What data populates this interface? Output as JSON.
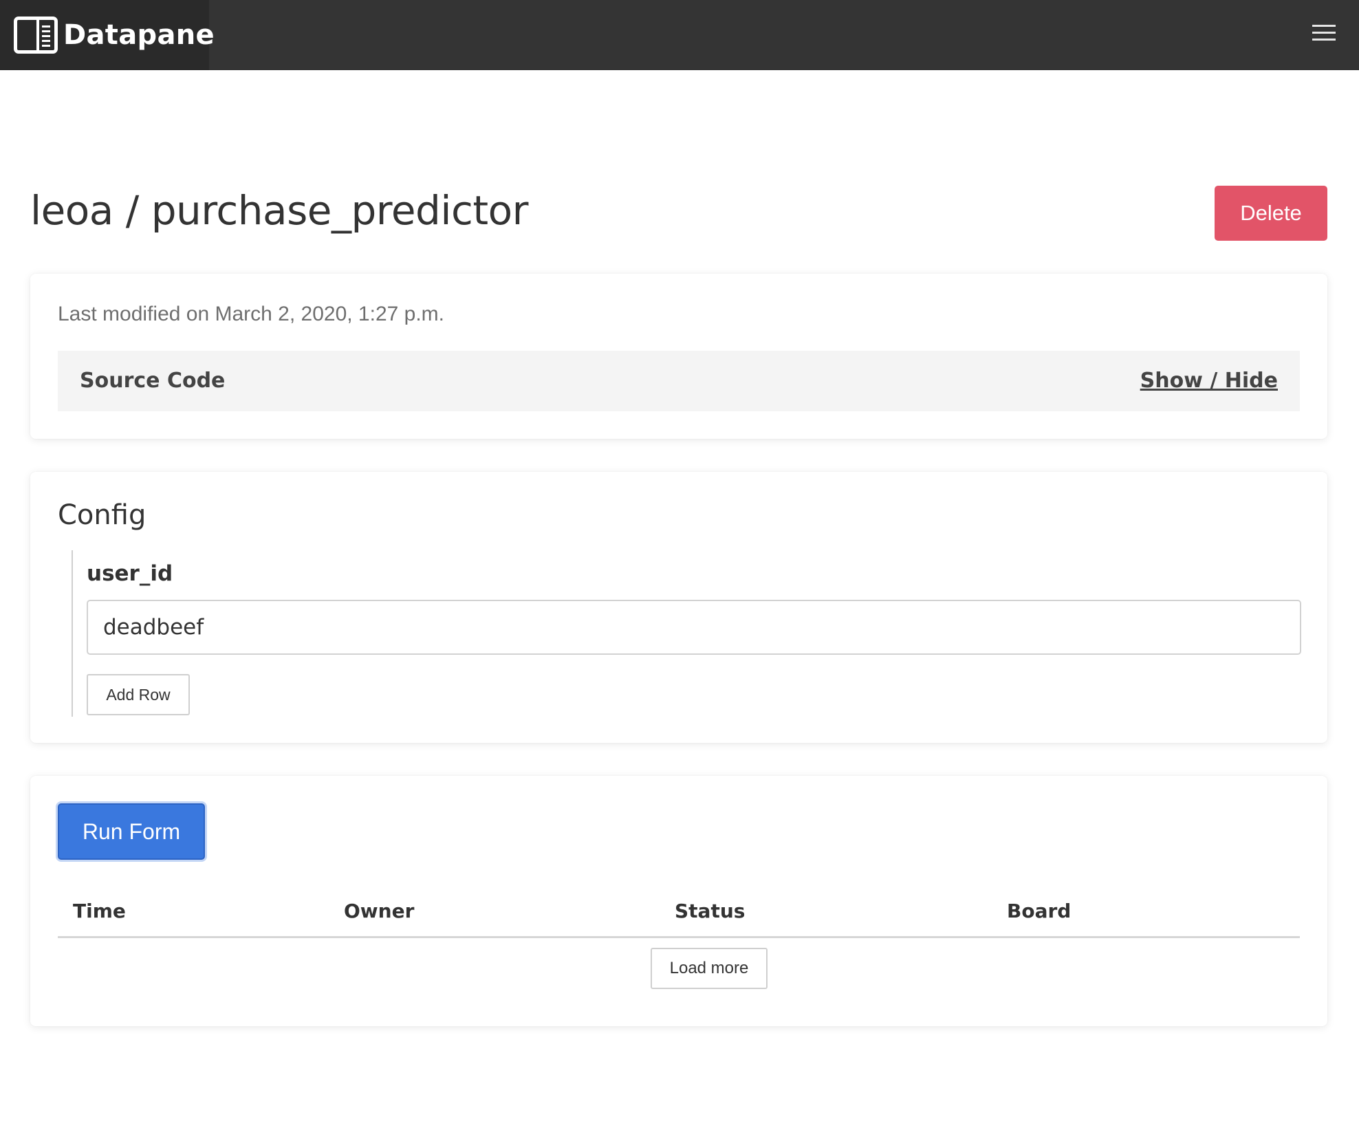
{
  "navbar": {
    "brand_name": "Datapane",
    "logo_icon": "datapane-logo-icon",
    "menu_icon": "hamburger-menu-icon",
    "background": "#343434"
  },
  "header": {
    "title": "leoa / purchase_predictor",
    "delete_label": "Delete",
    "delete_color": "#e25468"
  },
  "summary": {
    "last_modified": "Last modified on March 2, 2020, 1:27 p.m.",
    "source_code_label": "Source Code",
    "source_toggle_label": "Show / Hide"
  },
  "config": {
    "title": "Config",
    "fields": [
      {
        "label": "user_id",
        "value": "deadbeef"
      }
    ],
    "add_row_label": "Add Row"
  },
  "runs": {
    "run_label": "Run Form",
    "run_color": "#3a78de",
    "columns": [
      "Time",
      "Owner",
      "Status",
      "Board"
    ],
    "rows": [],
    "load_more_label": "Load more"
  }
}
